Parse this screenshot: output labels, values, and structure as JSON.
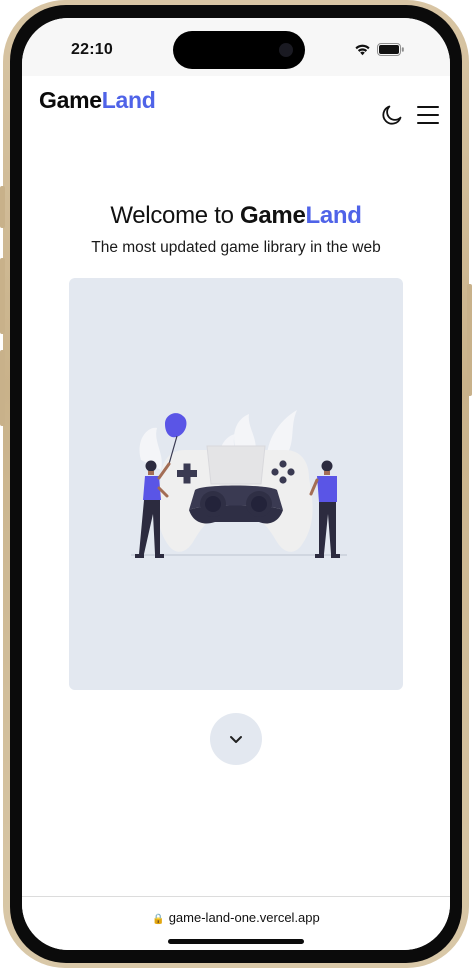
{
  "status": {
    "time": "22:10",
    "icons": [
      "wifi-icon",
      "battery-icon"
    ]
  },
  "header": {
    "logo_part1": "Game",
    "logo_part2": "Land",
    "icons": [
      "moon-icon",
      "menu-icon"
    ]
  },
  "hero": {
    "title_prefix": "Welcome to ",
    "title_brand1": "Game",
    "title_brand2": "Land",
    "subtitle": "The most updated game library in the web"
  },
  "illustration": "gamers-with-controller-illustration",
  "scroll_icon": "chevron-down-icon",
  "browser": {
    "url": "game-land-one.vercel.app",
    "lock_icon": "lock-icon"
  },
  "colors": {
    "brand_blue": "#4f63e8",
    "card_bg": "#e3e8f0",
    "person_shirt": "#5a55e6"
  }
}
